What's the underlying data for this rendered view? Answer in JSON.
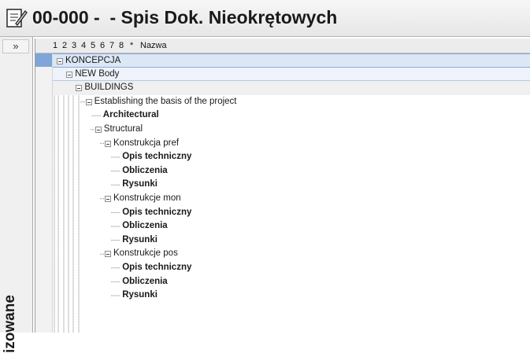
{
  "window": {
    "title": "00-000 -  - Spis Dok. Nieokrętowych"
  },
  "left_pane": {
    "expand_label": "»",
    "vertical_label": "izowane"
  },
  "grid": {
    "columns": [
      "1",
      "2",
      "3",
      "4",
      "5",
      "6",
      "7",
      "8",
      "*",
      "Nazwa"
    ]
  },
  "tree": [
    {
      "label": "KONCEPCJA",
      "level": 0,
      "bold": false,
      "expandable": true
    },
    {
      "label": "NEW Body",
      "level": 1,
      "bold": false,
      "expandable": true
    },
    {
      "label": "BUILDINGS",
      "level": 2,
      "bold": false,
      "expandable": true
    },
    {
      "label": "Establishing the basis of the project",
      "level": 3,
      "bold": false,
      "expandable": true
    },
    {
      "label": "Architectural",
      "level": 4,
      "bold": true,
      "expandable": false
    },
    {
      "label": "Structural",
      "level": 4,
      "bold": false,
      "expandable": true
    },
    {
      "label": "Konstrukcja pref",
      "level": 5,
      "bold": false,
      "expandable": true
    },
    {
      "label": "Opis techniczny",
      "level": 6,
      "bold": true,
      "expandable": false
    },
    {
      "label": "Obliczenia",
      "level": 6,
      "bold": true,
      "expandable": false
    },
    {
      "label": "Rysunki",
      "level": 6,
      "bold": true,
      "expandable": false
    },
    {
      "label": "Konstrukcje mon",
      "level": 5,
      "bold": false,
      "expandable": true
    },
    {
      "label": "Opis techniczny",
      "level": 6,
      "bold": true,
      "expandable": false
    },
    {
      "label": "Obliczenia",
      "level": 6,
      "bold": true,
      "expandable": false
    },
    {
      "label": "Rysunki",
      "level": 6,
      "bold": true,
      "expandable": false
    },
    {
      "label": "Konstrukcje pos",
      "level": 5,
      "bold": false,
      "expandable": true
    },
    {
      "label": "Opis techniczny",
      "level": 6,
      "bold": true,
      "expandable": false
    },
    {
      "label": "Obliczenia",
      "level": 6,
      "bold": true,
      "expandable": false
    },
    {
      "label": "Rysunki",
      "level": 6,
      "bold": true,
      "expandable": false
    }
  ]
}
